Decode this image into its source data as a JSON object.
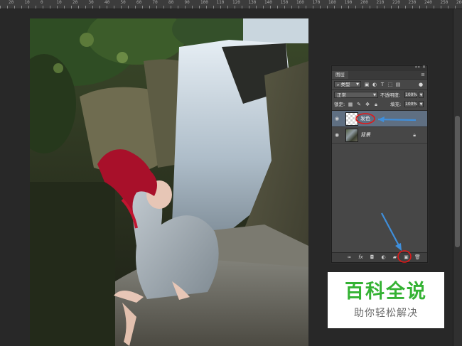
{
  "ruler": {
    "labels": [
      "20",
      "10",
      "0",
      "10",
      "20",
      "30",
      "40",
      "50",
      "60",
      "70",
      "80",
      "90",
      "100",
      "110",
      "120",
      "130",
      "140",
      "150",
      "160",
      "170",
      "180",
      "190",
      "200",
      "210",
      "220",
      "230",
      "240",
      "250",
      "260",
      "270"
    ]
  },
  "colors": {
    "accent_red": "#e01818",
    "arrow_blue": "#3f8fdc",
    "watermark_green": "#34b233",
    "selected_layer": "#5f6f82"
  },
  "layers_panel": {
    "tab_label": "图层",
    "filter_kind": "类型",
    "blend_mode": "正常",
    "opacity_label": "不透明度:",
    "opacity_value": "100%",
    "lock_label": "锁定:",
    "fill_label": "填充:",
    "fill_value": "100%",
    "layers": [
      {
        "name": "发色",
        "selected": true,
        "thumbnail": "transparent"
      },
      {
        "name": "背景",
        "selected": false,
        "thumbnail": "photo",
        "locked": true
      }
    ],
    "icons": {
      "filter": [
        "image-filter-icon",
        "adjustment-filter-icon",
        "type-filter-icon",
        "shape-filter-icon",
        "smart-object-filter-icon"
      ],
      "lock": [
        "lock-transparent-icon",
        "lock-paint-icon",
        "lock-move-icon",
        "lock-all-icon"
      ],
      "bottom": [
        "link-layers-icon",
        "fx-icon",
        "add-mask-icon",
        "adjustment-layer-icon",
        "new-group-icon",
        "new-layer-icon",
        "delete-layer-icon"
      ]
    }
  },
  "watermark": {
    "title": "百科全说",
    "subtitle": "助你轻松解决"
  }
}
